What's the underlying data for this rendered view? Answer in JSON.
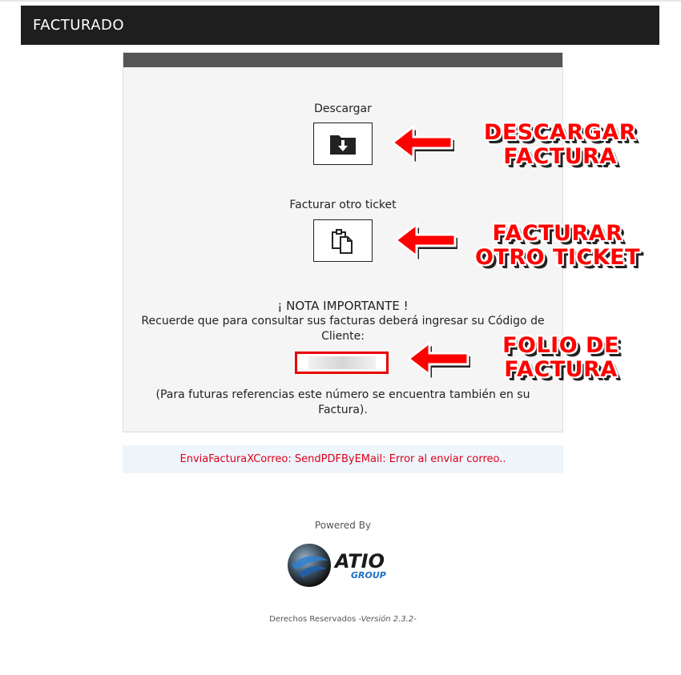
{
  "header": {
    "title": "FACTURADO"
  },
  "panel": {
    "download_label": "Descargar",
    "download_icon": "download-folder-icon",
    "another_label": "Facturar otro ticket",
    "another_icon": "copy-documents-icon",
    "nota_title": "¡ NOTA IMPORTANTE !",
    "nota_text": "Recuerde que para consultar sus facturas deberá ingresar su Código de Cliente:",
    "folio_value": "",
    "nota_bottom": "(Para futuras referencias este número se encuentra también en su Factura)."
  },
  "error": {
    "message": "EnviaFacturaXCorreo: SendPDFByEMail: Error al enviar correo.."
  },
  "footer": {
    "powered_by": "Powered By",
    "logo_text": "ATIO",
    "logo_sub": "GROUP",
    "rights": "Derechos Reservados",
    "version": "-Versión 2.3.2-"
  },
  "annotations": {
    "download_line1": "DESCARGAR",
    "download_line2": "FACTURA",
    "another_line1": "FACTURAR",
    "another_line2": "OTRO TICKET",
    "folio_line1": "FOLIO DE",
    "folio_line2": "FACTURA",
    "color": "#ff0000"
  },
  "colors": {
    "header_bg": "#1e1e1e",
    "error_text": "#e0001b",
    "error_bg": "#eef5fb",
    "folio_border": "#e60000"
  }
}
